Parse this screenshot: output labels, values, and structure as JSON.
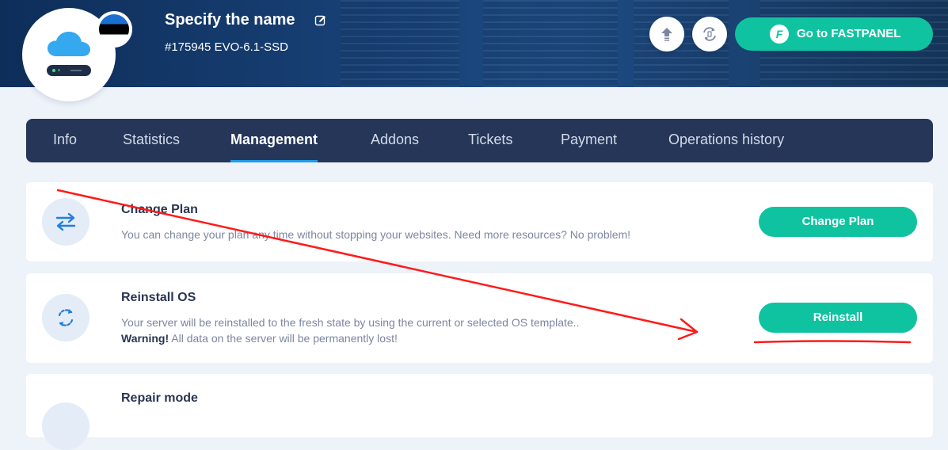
{
  "header": {
    "server_name": "Specify the name",
    "server_subtitle": "#175945 EVO-6.1-SSD",
    "fastpanel_label": "Go to FASTPANEL",
    "fastpanel_logo_letter": "F",
    "flag_country": "Estonia"
  },
  "tabs": [
    {
      "label": "Info",
      "active": false
    },
    {
      "label": "Statistics",
      "active": false
    },
    {
      "label": "Management",
      "active": true
    },
    {
      "label": "Addons",
      "active": false
    },
    {
      "label": "Tickets",
      "active": false
    },
    {
      "label": "Payment",
      "active": false
    },
    {
      "label": "Operations history",
      "active": false
    }
  ],
  "cards": {
    "change_plan": {
      "title": "Change Plan",
      "description": "You can change your plan any time without stopping your websites. Need more resources? No problem!",
      "button_label": "Change Plan"
    },
    "reinstall": {
      "title": "Reinstall OS",
      "description": "Your server will be reinstalled to the fresh state by using the current or selected OS template..",
      "warning_label": "Warning!",
      "warning_text": " All data on the server will be permanently lost!",
      "button_label": "Reinstall"
    },
    "repair": {
      "title": "Repair mode"
    }
  },
  "colors": {
    "accent": "#10c3a0",
    "tabs_bg": "#253659",
    "active_tab_underline": "#1e9bea",
    "annotation_red": "#ff0000",
    "page_bg": "#eef2f9"
  },
  "icons": {
    "edit": "edit-icon",
    "upgrade": "upload-arrow-icon",
    "reload": "reload-icon",
    "change_plan": "swap-arrows-icon",
    "reinstall": "reinstall-arrows-icon",
    "cloud": "cloud-icon"
  }
}
